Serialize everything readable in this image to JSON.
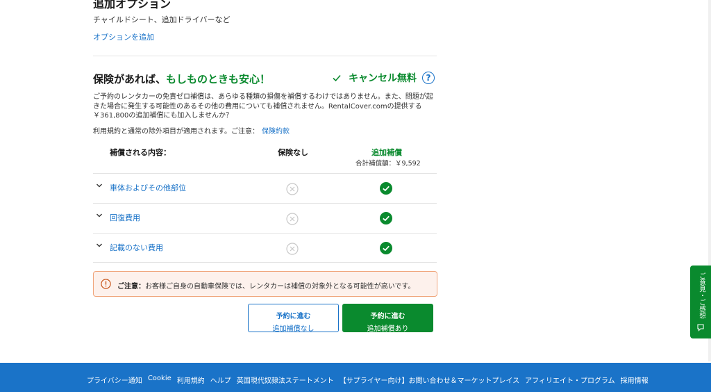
{
  "addon": {
    "title": "追加オプション",
    "description": "チャイルドシート、追加ドライバーなど",
    "link": "オプションを追加"
  },
  "insurance": {
    "title_prefix": "保険があれば、",
    "title_highlight": "もしものときも安心！",
    "cancel_label": "キャンセル無料",
    "help_symbol": "?",
    "body": "ご予約のレンタカーの免責ゼロ補償は、あらゆる種類の損傷を補償するわけではありません。また、問題が起きた場合に発生する可能性のあるその他の費用についても補償されません。RentalCover.comの提供する￥361,800の追加補償にも加入しませんか？",
    "terms_text": "利用規約と通常の除外項目が適用されます。ご注意：",
    "terms_link": "保険約款"
  },
  "table": {
    "col_coverage": "補償される内容：",
    "col_none": "保険なし",
    "col_extra": "追加補償",
    "col_extra_total": "合計補償額：￥9,592",
    "rows": [
      {
        "label": "車体およびその他部位"
      },
      {
        "label": "回復費用"
      },
      {
        "label": "記載のない費用"
      }
    ]
  },
  "notice": {
    "bold": "ご注意：",
    "text": "お客様ご自身の自動車保険では、レンタカーは補償の対象外となる可能性が高いです。"
  },
  "buttons": {
    "without": {
      "main": "予約に進む",
      "sub": "追加補償なし"
    },
    "with": {
      "main": "予約に進む",
      "sub": "追加補償あり"
    }
  },
  "feedback": {
    "label": "ご意見・ご感想"
  },
  "footer": {
    "links": [
      "プライバシー通知",
      "Cookie",
      "利用規約",
      "ヘルプ",
      "英国現代奴隷法ステートメント",
      "【サプライヤー向け】お問い合わせ＆マーケットプレイス",
      "アフィリエイト・プログラム",
      "採用情報"
    ]
  },
  "colors": {
    "accent_blue": "#1a73c8",
    "accent_green": "#0a8a2e",
    "notice_bg": "#fdf1ec",
    "notice_border": "#f0a57b"
  },
  "icons": {
    "cancel": "check-icon",
    "help": "question-circle-icon",
    "expand": "chevron-down-icon",
    "not_covered": "x-circle-icon",
    "covered": "check-circle-icon",
    "notice": "warning-circle-icon",
    "feedback": "chat-bubble-icon"
  }
}
